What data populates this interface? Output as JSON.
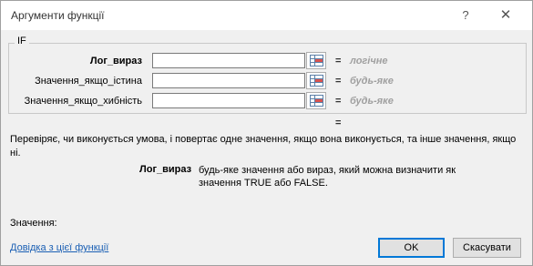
{
  "window": {
    "title": "Аргументи функції",
    "help_label": "?",
    "close_label": "✕"
  },
  "function_name": "IF",
  "arguments": [
    {
      "label": "Лог_вираз",
      "value": "",
      "eq": "=",
      "hint": "логічне"
    },
    {
      "label": "Значення_якщо_істина",
      "value": "",
      "eq": "=",
      "hint": "будь-яке"
    },
    {
      "label": "Значення_якщо_хибність",
      "value": "",
      "eq": "=",
      "hint": "будь-яке"
    }
  ],
  "result_eq": "=",
  "description": "Перевіряє, чи виконується умова, і повертає одне значення, якщо вона виконується, та інше значення, якщо ні.",
  "current_argument": {
    "name": "Лог_вираз",
    "text": "будь-яке значення або вираз, який можна визначити як значення TRUE або FALSE."
  },
  "value_label": "Значення:",
  "help_link": "Довідка з цієї функції",
  "buttons": {
    "ok": "OK",
    "cancel": "Скасувати"
  },
  "icons": {
    "ref_button": "range-select-icon"
  }
}
